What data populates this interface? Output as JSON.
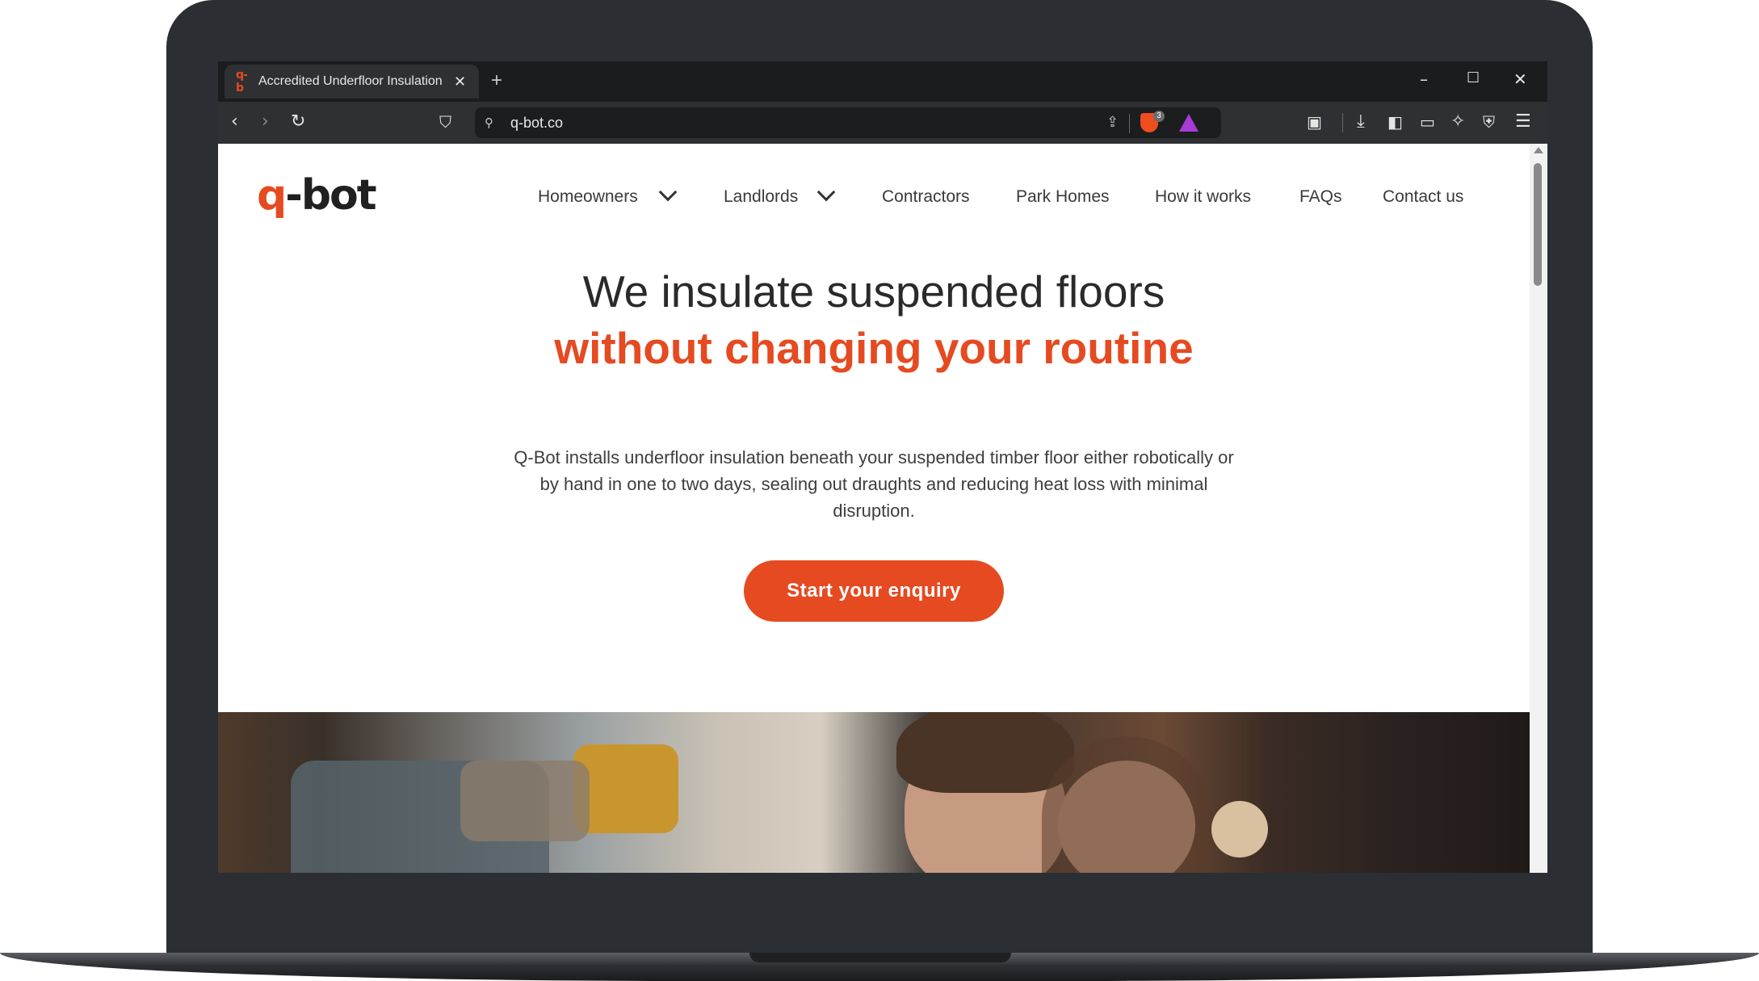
{
  "browser": {
    "tab": {
      "favicon": "q-b",
      "title": "Accredited Underfloor Insulation",
      "close": "✕"
    },
    "new_tab": "+",
    "window_controls": {
      "minimize": "–",
      "maximize": "☐",
      "close": "✕"
    },
    "url": "q-bot.co",
    "brave_shields_count": "3"
  },
  "site": {
    "logo": {
      "q": "q",
      "rest": "-bot"
    },
    "nav": [
      {
        "label": "Homeowners",
        "has_dropdown": true
      },
      {
        "label": "Landlords",
        "has_dropdown": true
      },
      {
        "label": "Contractors"
      },
      {
        "label": "Park Homes"
      },
      {
        "label": "How it works"
      },
      {
        "label": "FAQs"
      },
      {
        "label": "Contact us"
      }
    ],
    "hero": {
      "headline_1": "We insulate suspended floors",
      "headline_2": "without changing your routine",
      "description": "Q-Bot installs underfloor insulation beneath your suspended timber floor either robotically or by hand in one to two days, sealing out draughts and reducing heat loss with minimal disruption.",
      "cta": "Start your enquiry"
    }
  },
  "colors": {
    "brand": "#e54a21",
    "text": "#2a2a2a",
    "browser_chrome": "#2e3033"
  }
}
